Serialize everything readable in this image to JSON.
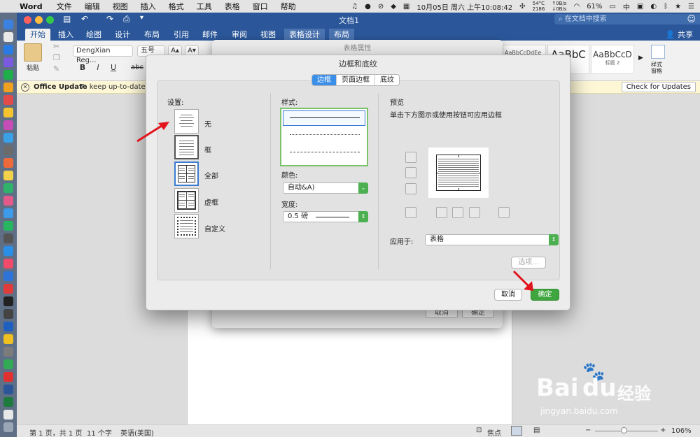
{
  "menubar": {
    "app": "Word",
    "items": [
      "文件",
      "编辑",
      "视图",
      "插入",
      "格式",
      "工具",
      "表格",
      "窗口",
      "帮助"
    ],
    "temp": "54°C",
    "rpm": "2186",
    "net_up": "0B/s",
    "net_down": "0B/s",
    "datetime": "10月05日 周六 上午10:08:42",
    "battery": "61%",
    "ime": "中"
  },
  "window": {
    "title": "文档1",
    "search_placeholder": "在文档中搜索",
    "share_label": "共享"
  },
  "tabs": [
    "开始",
    "插入",
    "绘图",
    "设计",
    "布局",
    "引用",
    "邮件",
    "审阅",
    "视图",
    "表格设计",
    "布局"
  ],
  "ribbon": {
    "paste_label": "粘贴",
    "font_name": "DengXian Reg...",
    "font_size": "五号",
    "grow_font": "A",
    "shrink_font": "A",
    "bold": "B",
    "italic": "I",
    "underline": "U",
    "strike": "abc",
    "style1_preview": "AaBbCcDdEe",
    "style2_preview": "AaBbC",
    "style2_name": "1",
    "style3_preview": "AaBbCcD",
    "style3_name": "标题 2",
    "styles_pane_label": "样式\n窗格"
  },
  "update_bar": {
    "icon": "close-circle-icon",
    "title": "Office Update",
    "text": "To keep up-to-date wi",
    "button": "Check for Updates"
  },
  "bg_dialog": {
    "title": "表格属性",
    "cancel": "取消",
    "ok": "确定"
  },
  "dialog": {
    "title": "边框和底纹",
    "segments": [
      "边框",
      "页面边框",
      "底纹"
    ],
    "selected_segment": "边框",
    "settings_label": "设置:",
    "settings": [
      "无",
      "框",
      "全部",
      "虚框",
      "自定义"
    ],
    "selected_setting": "全部",
    "style_label": "样式:",
    "color_label": "颜色:",
    "color_value": "自动&A)",
    "width_label": "宽度:",
    "width_value": "0.5 磅",
    "preview_label": "预览",
    "preview_hint": "单击下方图示或使用按钮可应用边框",
    "apply_label": "应用于:",
    "apply_value": "表格",
    "options_button": "选项...",
    "cancel_button": "取消",
    "ok_button": "确定",
    "accent": "#3fa63f"
  },
  "statusbar": {
    "page": "第 1 页，共 1 页",
    "words": "11 个字",
    "language": "英语(美国)",
    "focus": "焦点",
    "zoom": "106%"
  },
  "watermark": {
    "brand": "Bai",
    "brand2": "du",
    "cn": "经验",
    "url": "jingyan.baidu.com"
  }
}
